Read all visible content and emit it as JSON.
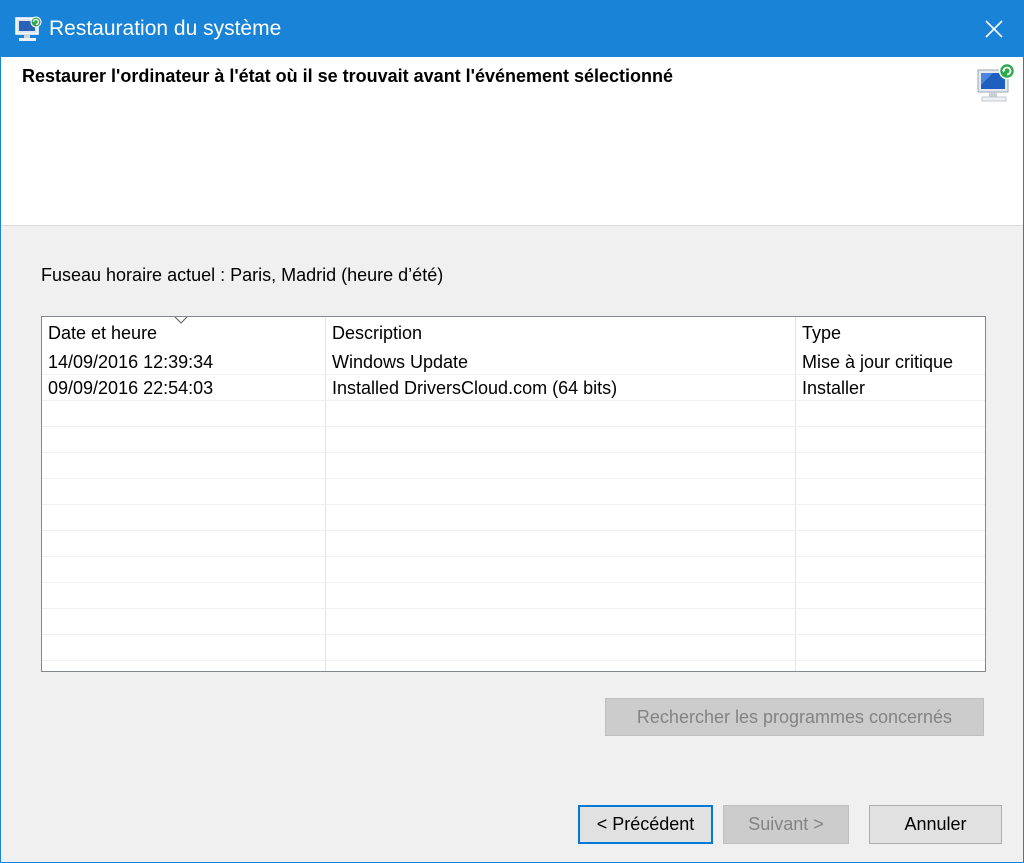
{
  "window": {
    "title": "Restauration du système",
    "accent_color": "#1883d7",
    "close_icon": "close-icon",
    "app_icon": "system-restore-icon"
  },
  "header": {
    "title": "Restaurer l'ordinateur à l'état où il se trouvait avant l'événement sélectionné",
    "icon": "system-restore-icon"
  },
  "timezone": {
    "label": "Fuseau horaire actuel : ",
    "value": "Paris, Madrid (heure d’été)"
  },
  "table": {
    "columns": [
      "Date et heure",
      "Description",
      "Type"
    ],
    "sort_icon": "chevron-down-icon",
    "rows": [
      {
        "date": "14/09/2016 12:39:34",
        "description": "Windows Update",
        "type": "Mise à jour critique"
      },
      {
        "date": "09/09/2016 22:54:03",
        "description": "Installed DriversCloud.com (64 bits)",
        "type": "Installer"
      }
    ]
  },
  "buttons": {
    "scan": "Rechercher les programmes concernés",
    "previous": "< Précédent",
    "next": "Suivant >",
    "cancel": "Annuler"
  }
}
